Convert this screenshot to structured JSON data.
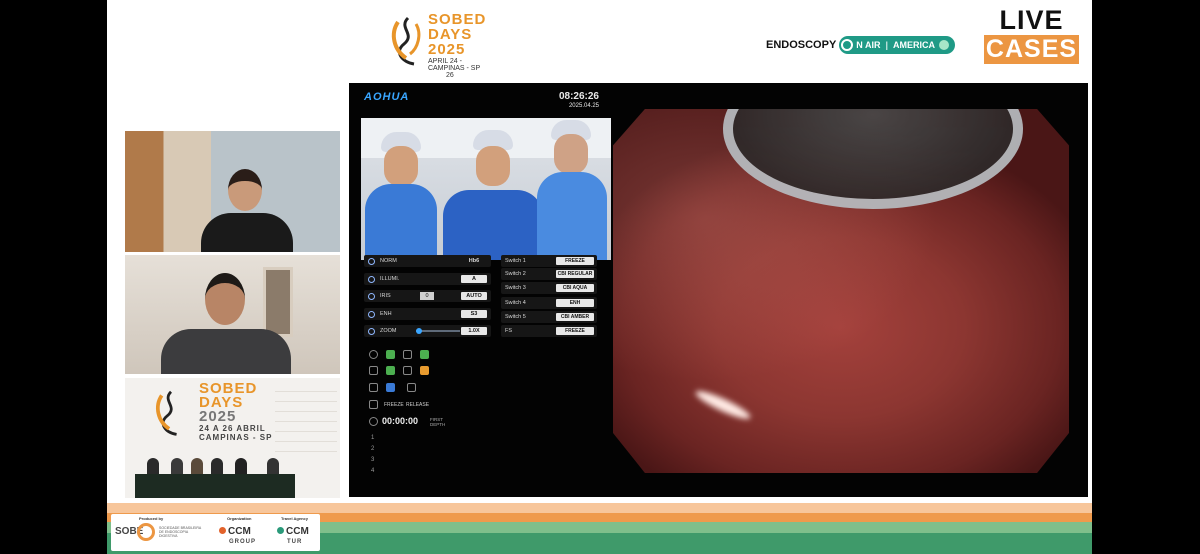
{
  "header": {
    "logo": {
      "line1": "SOBED",
      "line2": "DAYS",
      "year": "2025",
      "dates": "APRIL 24 -",
      "city": "CAMPINAS - SP",
      "day_end": "26"
    },
    "endoscopy_label": "ENDOSCOPY",
    "on_air_label": "N AIR",
    "america_label": "AMERICA",
    "live_label": "LIVE",
    "cases_label": "CASES"
  },
  "colors": {
    "brand_orange": "#ec9642",
    "on_air_green": "#1f9a86",
    "scope_blue": "#3aa6ff"
  },
  "participants": {
    "panel3": {
      "line1": "SOBED",
      "line2": "DAYS",
      "year": "2025",
      "dates": "24 A 26 ABRIL",
      "city": "CAMPINAS - SP"
    }
  },
  "monitor": {
    "brand": "AOHUA",
    "time": "08:26:26",
    "date": "2025.04.25",
    "controls": [
      {
        "label": "NORM",
        "mini": "",
        "value": "Hb6"
      },
      {
        "label": "ILLUMI.",
        "mini": "",
        "value": "A"
      },
      {
        "label": "IRIS",
        "mini": "0",
        "value": "AUTO"
      },
      {
        "label": "ENH",
        "mini": "",
        "value": "S3"
      },
      {
        "label": "ZOOM",
        "mini": "",
        "value": "1.0X"
      }
    ],
    "switches": [
      {
        "label": "Switch 1",
        "value": "FREEZE"
      },
      {
        "label": "Switch 2",
        "value": "CBI REGULAR"
      },
      {
        "label": "Switch 3",
        "value": "CBI AQUA"
      },
      {
        "label": "Switch 4",
        "value": "ENH"
      },
      {
        "label": "Switch 5",
        "value": "CBI AMBER"
      },
      {
        "label": "FS",
        "value": "FREEZE"
      }
    ],
    "freeze_label": "FREEZE",
    "release_label": "RELEASE",
    "timer": "00:00:00",
    "timer_tag": "FIRST DEPTH",
    "numbers": [
      "1",
      "2",
      "3",
      "4"
    ]
  },
  "footer": {
    "produced_by": "Produced by",
    "organization": "Organization",
    "travel_agency": "Travel Agency",
    "sobed_short": "SOBE",
    "sobed_desc": "SOCIEDADE BRASILEIRA DE ENDOSCOPIA DIGESTIVA",
    "ccm_group": "CCM",
    "ccm_group_sub": "GROUP",
    "ccm_tur": "CCM",
    "ccm_tur_sub": "TUR"
  }
}
